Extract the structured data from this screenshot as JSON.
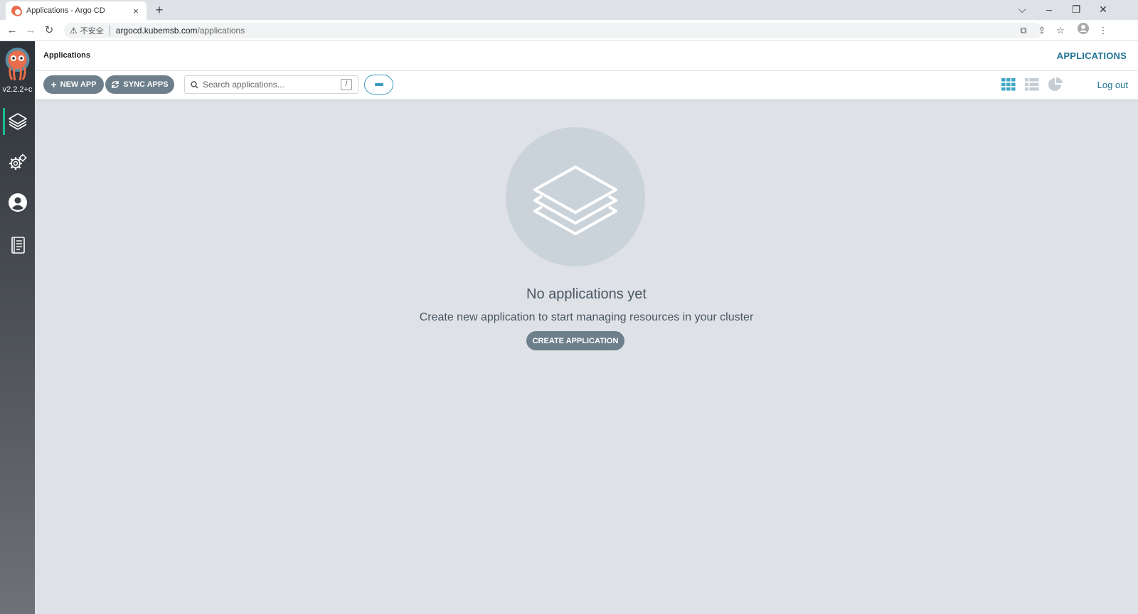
{
  "browser": {
    "tab_title": "Applications - Argo CD",
    "tab_close": "×",
    "new_tab": "+",
    "insecure_label": "不安全",
    "url_host": "argocd.kubemsb.com",
    "url_path": "/applications"
  },
  "sidebar": {
    "version": "v2.2.2+c",
    "items": [
      {
        "name": "applications",
        "icon": "layers-icon",
        "active": true
      },
      {
        "name": "settings",
        "icon": "gears-icon",
        "active": false
      },
      {
        "name": "user-info",
        "icon": "user-circle-icon",
        "active": false
      },
      {
        "name": "documentation",
        "icon": "book-icon",
        "active": false
      }
    ]
  },
  "header": {
    "breadcrumb": "Applications",
    "title": "APPLICATIONS"
  },
  "toolbar": {
    "new_app_label": "NEW APP",
    "sync_apps_label": "SYNC APPS",
    "search_placeholder": "Search applications...",
    "search_shortcut": "/",
    "logout_label": "Log out"
  },
  "empty_state": {
    "title": "No applications yet",
    "subtitle": "Create new application to start managing resources in your cluster",
    "button_label": "CREATE APPLICATION"
  },
  "colors": {
    "accent": "#227595",
    "button_bg": "#6d7f8b",
    "sidebar_active": "#18be94",
    "tile_icon": "#3fa6c5"
  }
}
